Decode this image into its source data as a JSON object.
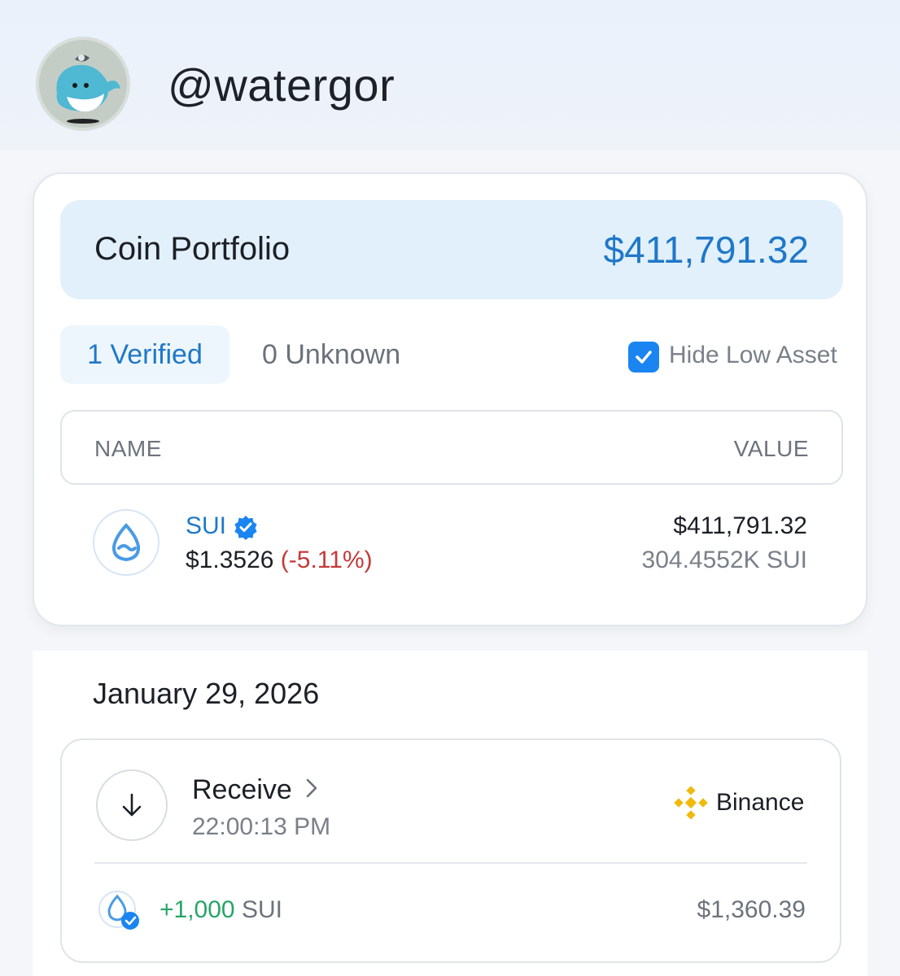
{
  "profile": {
    "username": "@watergor"
  },
  "portfolio": {
    "title": "Coin Portfolio",
    "total": "$411,791.32",
    "tabs": [
      "1 Verified",
      "0 Unknown"
    ],
    "hide_low_asset_label": "Hide Low Asset",
    "hide_low_asset_checked": true,
    "table_headers": {
      "name": "NAME",
      "value": "VALUE"
    },
    "coins": [
      {
        "symbol": "SUI",
        "price": "$1.3526",
        "change": "(-5.11%)",
        "value": "$411,791.32",
        "amount": "304.4552K SUI"
      }
    ]
  },
  "activity": {
    "date": "January 29, 2026",
    "transactions": [
      {
        "type": "Receive",
        "time": "22:00:13 PM",
        "exchange": "Binance",
        "amount_value": "+1,000",
        "amount_unit": "SUI",
        "usd_value": "$1,360.39"
      }
    ]
  },
  "colors": {
    "accent_blue": "#1f78c8",
    "negative_red": "#c43a3a",
    "positive_green": "#27a567",
    "binance_yellow": "#f0b90b"
  }
}
